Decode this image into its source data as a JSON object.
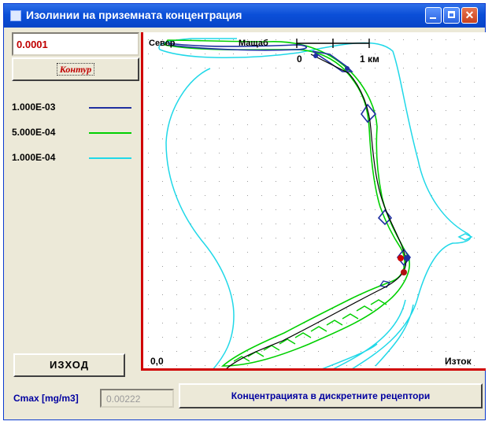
{
  "window": {
    "title": "Изолинии на приземната концентрация",
    "close_glyph": "✕"
  },
  "left_panel": {
    "value_input": "0.0001",
    "contour_button": "Контур",
    "legend": [
      {
        "label": "1.000E-03",
        "color": "#1f2fa0"
      },
      {
        "label": "5.000E-04",
        "color": "#00d000"
      },
      {
        "label": "1.000E-04",
        "color": "#20d8e8"
      }
    ],
    "exit_button": "ИЗХОД"
  },
  "map": {
    "north_label": "Север",
    "scale_label": "Мащаб",
    "scale_zero": "0",
    "scale_km": "1 км",
    "origin_label": "0,0",
    "east_label": "Изток",
    "axis_color": "#d00000"
  },
  "bottom": {
    "cmax_label": "Cmax [mg/m3]",
    "cmax_value": "0.00222",
    "concentration_button": "Концентрацията в дискретните рецептори"
  }
}
